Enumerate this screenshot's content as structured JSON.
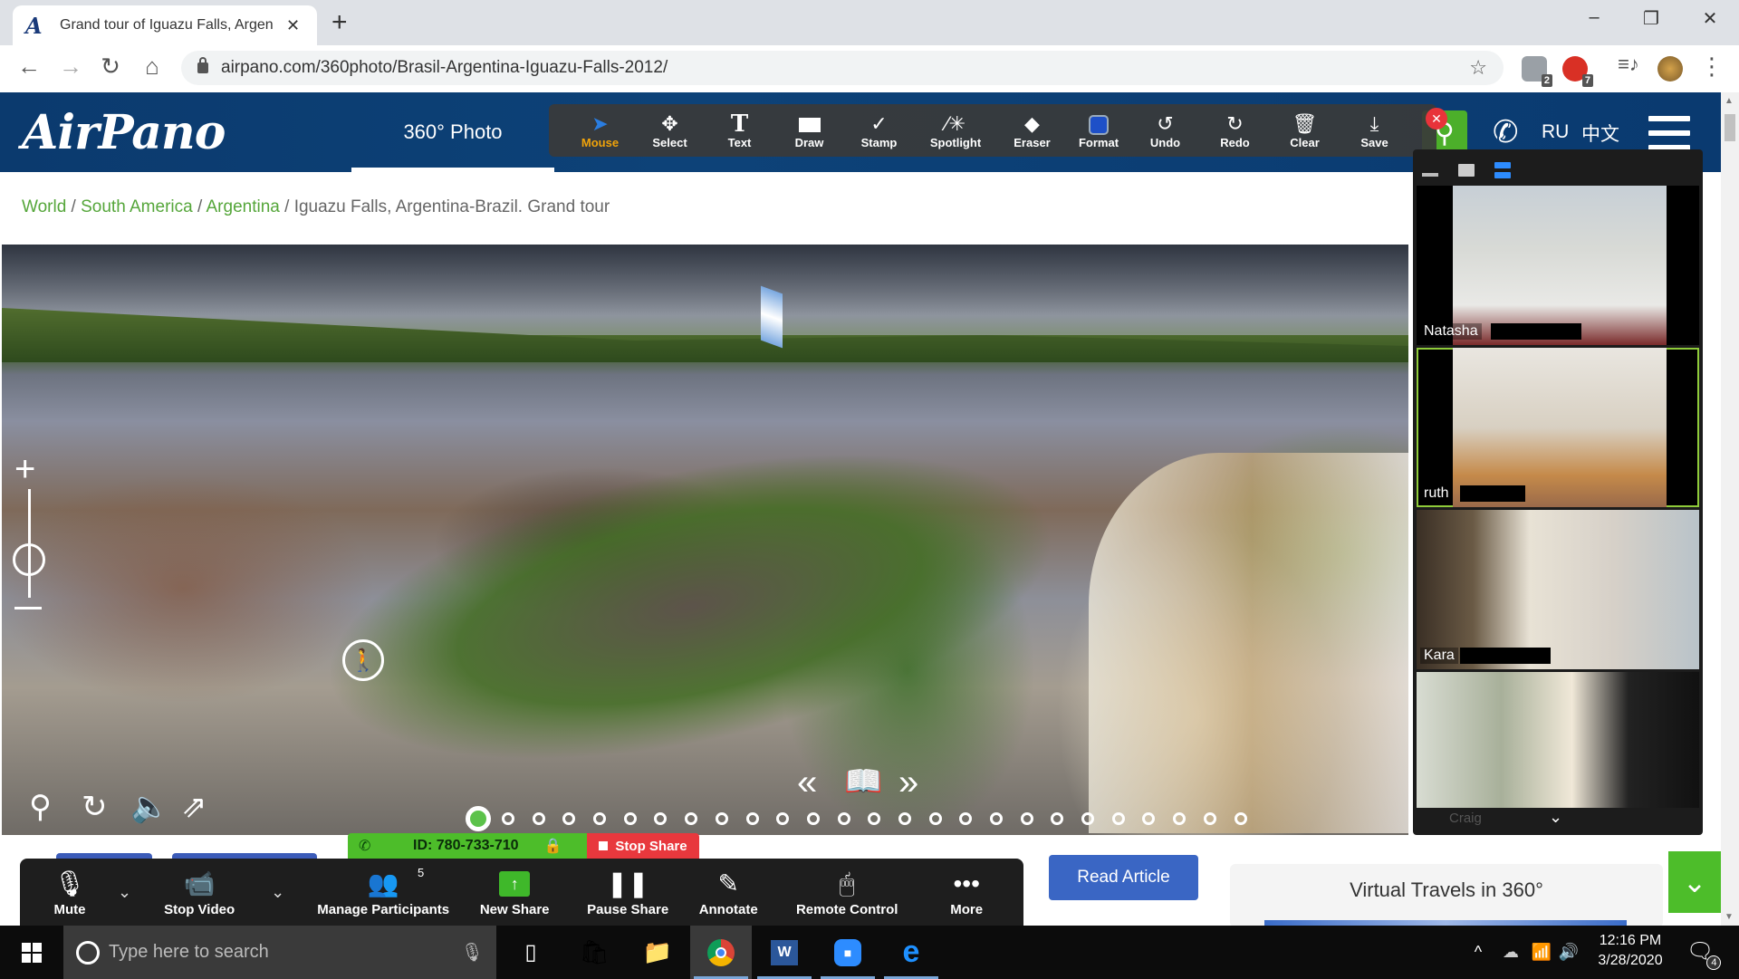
{
  "browser": {
    "tab_title": "Grand tour of Iguazu Falls, Argen",
    "tab_favicon": "A",
    "new_tab": "+",
    "url": "airpano.com/360photo/Brasil-Argentina-Iguazu-Falls-2012/",
    "window_controls": {
      "minimize": "–",
      "restore": "❐",
      "close": "✕"
    },
    "extensions": [
      {
        "name": "privacy-badger-icon",
        "badge": "2",
        "color": "#9aa0a6"
      },
      {
        "name": "adblock-icon",
        "badge": "7",
        "color": "#d93025"
      }
    ]
  },
  "site": {
    "logo": "AirPano",
    "nav_active": "360° Photo",
    "lang_ru": "RU",
    "lang_zh": "中文",
    "brand_color": "#0b3a6e",
    "accent_green": "#4caf2a"
  },
  "breadcrumb": {
    "links": [
      "World",
      "South America",
      "Argentina"
    ],
    "current": "Iguazu Falls, Argentina-Brazil. Grand tour",
    "separator": " / "
  },
  "annotation_toolbar": {
    "tools": [
      {
        "id": "mouse",
        "label": "Mouse",
        "icon": "cursor-arrow-icon",
        "active": true
      },
      {
        "id": "select",
        "label": "Select",
        "icon": "move-arrows-icon",
        "active": false
      },
      {
        "id": "text",
        "label": "Text",
        "icon": "text-T-icon",
        "active": false
      },
      {
        "id": "draw",
        "label": "Draw",
        "icon": "rectangle-icon",
        "active": false
      },
      {
        "id": "stamp",
        "label": "Stamp",
        "icon": "checkmark-icon",
        "active": false
      },
      {
        "id": "spotlight",
        "label": "Spotlight",
        "icon": "magic-wand-icon",
        "active": false
      },
      {
        "id": "eraser",
        "label": "Eraser",
        "icon": "eraser-icon",
        "active": false
      },
      {
        "id": "format",
        "label": "Format",
        "icon": "color-square-icon",
        "active": false
      },
      {
        "id": "undo",
        "label": "Undo",
        "icon": "undo-icon",
        "active": false
      },
      {
        "id": "redo",
        "label": "Redo",
        "icon": "redo-icon",
        "active": false
      },
      {
        "id": "clear",
        "label": "Clear",
        "icon": "trash-icon",
        "active": false
      },
      {
        "id": "save",
        "label": "Save",
        "icon": "download-icon",
        "active": false
      }
    ],
    "active_color": "#f0a30a",
    "format_color": "#1e50c8"
  },
  "panorama": {
    "pages_total": 26,
    "current_page": 1,
    "controls": [
      "map-pin-icon",
      "autorotate-icon",
      "sound-icon",
      "share-icon"
    ]
  },
  "video_panel": {
    "participants": [
      {
        "name": "Natasha",
        "speaking": false
      },
      {
        "name": "ruth",
        "speaking": true
      },
      {
        "name": "Kara",
        "speaking": false
      },
      {
        "name": "Craig",
        "speaking": false
      }
    ]
  },
  "meeting": {
    "id_label": "ID: 780-733-710",
    "stop_share": "Stop Share"
  },
  "zoom_toolbar": {
    "mute": "Mute",
    "stop_video": "Stop Video",
    "manage_participants": "Manage Participants",
    "participant_count": "5",
    "new_share": "New Share",
    "pause_share": "Pause Share",
    "annotate": "Annotate",
    "remote_control": "Remote Control",
    "more": "More"
  },
  "page_bottom": {
    "read_article": "Read Article",
    "virtual_travels": "Virtual Travels in 360°"
  },
  "taskbar": {
    "search_placeholder": "Type here to search",
    "time": "12:16 PM",
    "date": "3/28/2020",
    "notifications": "4",
    "apps": [
      "task-view",
      "microsoft-store",
      "file-explorer",
      "chrome",
      "word",
      "zoom",
      "edge"
    ]
  }
}
